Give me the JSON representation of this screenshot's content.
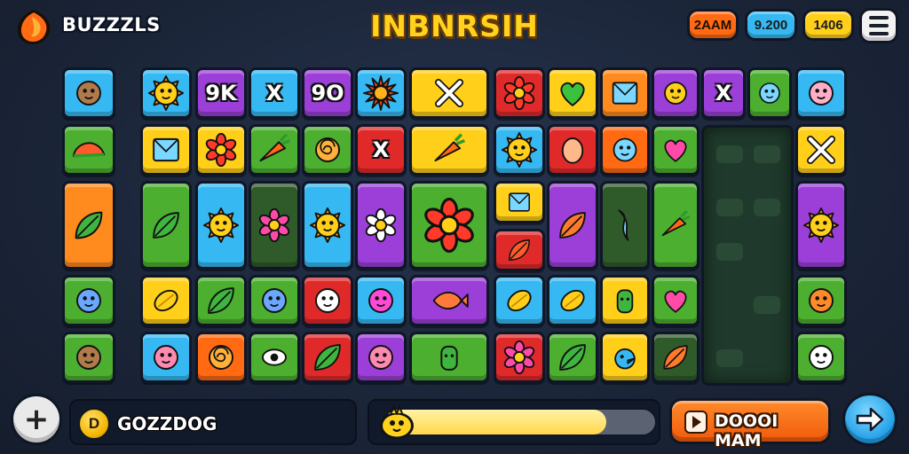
{
  "header": {
    "app_name": "BUZZZLS",
    "title": "INBNRSIH",
    "stats": [
      "2AAM",
      "9.200",
      "1406"
    ]
  },
  "bottom": {
    "coin_symbol": "D",
    "coin_label": "GOZZDOG",
    "progress": 0.82,
    "action_label": "DOOOI MAM"
  },
  "icons": {
    "logo": "flame-shield-icon",
    "menu": "hamburger-menu-icon",
    "add": "plus-icon",
    "coin": "coin-icon",
    "mascot": "yellow-chick-icon",
    "action": "play-arrow-icon",
    "next": "arrow-right-icon"
  },
  "colors": {
    "orange": "#ff6a13",
    "blue": "#36b9f2",
    "yellow": "#ffcf1a",
    "green": "#4caf2f",
    "purple": "#9b3fd8",
    "red": "#e02a2a",
    "dark_green": "#2f5a2a"
  },
  "tiles": [
    {
      "icon": "owl-face-icon",
      "color": "#36b9f2"
    },
    {
      "icon": "melon-slice-icon",
      "color": "#4caf2f"
    },
    {
      "icon": "leaf-pair-icon",
      "color": "#ff8a1e"
    },
    {
      "icon": "cat-face-icon",
      "color": "#4caf2f"
    },
    {
      "icon": "owl-face-icon",
      "color": "#4caf2f"
    },
    {
      "icon": "sun-face-icon",
      "color": "#36b9f2"
    },
    {
      "icon": "envelope-icon",
      "color": "#ffcf1a"
    },
    {
      "icon": "fern-icon",
      "color": "#4caf2f"
    },
    {
      "icon": "banana-icon",
      "color": "#ffcf1a"
    },
    {
      "icon": "fish-face-icon",
      "color": "#36b9f2"
    },
    {
      "icon": "ok-glyph-icon",
      "color": "#9b3fd8",
      "glyph": "9K"
    },
    {
      "icon": "flower-red-icon",
      "color": "#ffcf1a"
    },
    {
      "icon": "sun-face-icon",
      "color": "#36b9f2"
    },
    {
      "icon": "leaf-icon",
      "color": "#4caf2f"
    },
    {
      "icon": "seashell-icon",
      "color": "#ff6a13"
    },
    {
      "icon": "x-glyph-icon",
      "color": "#36b9f2",
      "glyph": "X"
    },
    {
      "icon": "chili-icon",
      "color": "#4caf2f"
    },
    {
      "icon": "tulip-icon",
      "color": "#2f5a2a"
    },
    {
      "icon": "cat-face-icon",
      "color": "#4caf2f"
    },
    {
      "icon": "eye-icon",
      "color": "#4caf2f"
    },
    {
      "icon": "qo-glyph-icon",
      "color": "#9b3fd8",
      "glyph": "9O"
    },
    {
      "icon": "spiral-icon",
      "color": "#4caf2f"
    },
    {
      "icon": "sun-face-icon",
      "color": "#36b9f2"
    },
    {
      "icon": "ghost-face-icon",
      "color": "#e02a2a"
    },
    {
      "icon": "leaf-icon",
      "color": "#e02a2a"
    },
    {
      "icon": "sunburst-icon",
      "color": "#36b9f2"
    },
    {
      "icon": "x-glyph-icon",
      "color": "#e02a2a",
      "glyph": "X"
    },
    {
      "icon": "daisy-icon",
      "color": "#9b3fd8"
    },
    {
      "icon": "blob-face-icon",
      "color": "#36b9f2"
    },
    {
      "icon": "fish-face-icon",
      "color": "#9b3fd8"
    },
    {
      "icon": "knife-icon",
      "color": "#ffcf1a"
    },
    {
      "icon": "carrot-icon",
      "color": "#ffcf1a"
    },
    {
      "icon": "sunflower-icon",
      "color": "#4caf2f"
    },
    {
      "icon": "fish-icon",
      "color": "#9b3fd8"
    },
    {
      "icon": "cactus-icon",
      "color": "#4caf2f"
    },
    {
      "icon": "flower-red-icon",
      "color": "#e02a2a"
    },
    {
      "icon": "sun-face-icon",
      "color": "#36b9f2"
    },
    {
      "icon": "ice-cube-icon",
      "color": "#ffcf1a"
    },
    {
      "icon": "leaf-red-icon",
      "color": "#e02a2a"
    },
    {
      "icon": "seed-icon",
      "color": "#36b9f2"
    },
    {
      "icon": "flower-pink-icon",
      "color": "#e02a2a"
    },
    {
      "icon": "heart-green-icon",
      "color": "#ffcf1a"
    },
    {
      "icon": "egg-icon",
      "color": "#e02a2a"
    },
    {
      "icon": "feather-icon",
      "color": "#9b3fd8"
    },
    {
      "icon": "lemon-icon",
      "color": "#36b9f2"
    },
    {
      "icon": "leaf-icon",
      "color": "#4caf2f"
    },
    {
      "icon": "mirror-icon",
      "color": "#ff8a1e"
    },
    {
      "icon": "bunny-face-icon",
      "color": "#ff6a13"
    },
    {
      "icon": "wave-icon",
      "color": "#2f5a2a"
    },
    {
      "icon": "virus-icon",
      "color": "#ffcf1a"
    },
    {
      "icon": "bird-icon",
      "color": "#ffcf1a"
    },
    {
      "icon": "bulb-face-icon",
      "color": "#9b3fd8"
    },
    {
      "icon": "heart-pink-icon",
      "color": "#4caf2f"
    },
    {
      "icon": "carrot-icon",
      "color": "#4caf2f"
    },
    {
      "icon": "heart-pink-icon",
      "color": "#4caf2f"
    },
    {
      "icon": "feather-icon",
      "color": "#2f5a2a"
    },
    {
      "icon": "x-glyph-icon",
      "color": "#9b3fd8",
      "glyph": "X"
    },
    {
      "icon": "drop-face-icon",
      "color": "#4caf2f"
    },
    {
      "icon": "pig-face-icon",
      "color": "#36b9f2"
    },
    {
      "icon": "crossed-swords-icon",
      "color": "#ffcf1a"
    },
    {
      "icon": "sun-face-icon",
      "color": "#9b3fd8"
    },
    {
      "icon": "pumpkin-face-icon",
      "color": "#4caf2f"
    },
    {
      "icon": "ghost-face-icon",
      "color": "#4caf2f"
    }
  ]
}
